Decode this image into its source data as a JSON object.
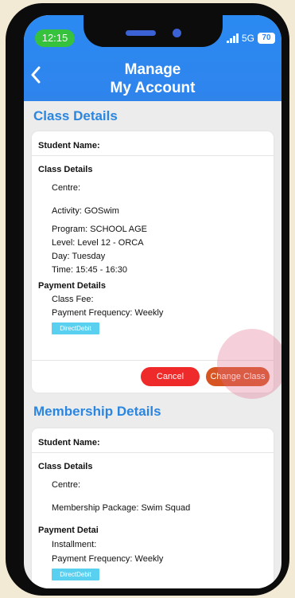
{
  "status_bar": {
    "time": "12:15",
    "network": "5G",
    "battery": "70"
  },
  "header": {
    "title_line1": "Manage",
    "title_line2": "My Account"
  },
  "class_section": {
    "title": "Class Details",
    "student_label": "Student Name:",
    "details_heading": "Class Details",
    "centre": "Centre:",
    "activity": "Activity: GOSwim",
    "program": "Program: SCHOOL AGE",
    "level": "Level: Level 12 - ORCA",
    "day": "Day: Tuesday",
    "time": "Time: 15:45 - 16:30",
    "payment_heading": "Payment Details",
    "class_fee": "Class Fee:",
    "payment_frequency": "Payment Frequency: Weekly",
    "payment_badge": "DirectDebit",
    "cancel_label": "Cancel",
    "change_label": "Change Class"
  },
  "membership_section": {
    "title": "Membership Details",
    "student_label": "Student Name:",
    "details_heading": "Class Details",
    "centre": "Centre:",
    "package": "Membership Package: Swim Squad",
    "payment_heading": "Payment Detai",
    "installment": "Installment:",
    "payment_frequency": "Payment Frequency: Weekly",
    "payment_badge": "DirectDebit"
  },
  "colors": {
    "header_blue": "#2f84ec",
    "section_title_blue": "#2a86e0",
    "cancel_red": "#ee2a2a",
    "change_orange": "#d75423",
    "badge_cyan": "#5ad0f0"
  }
}
